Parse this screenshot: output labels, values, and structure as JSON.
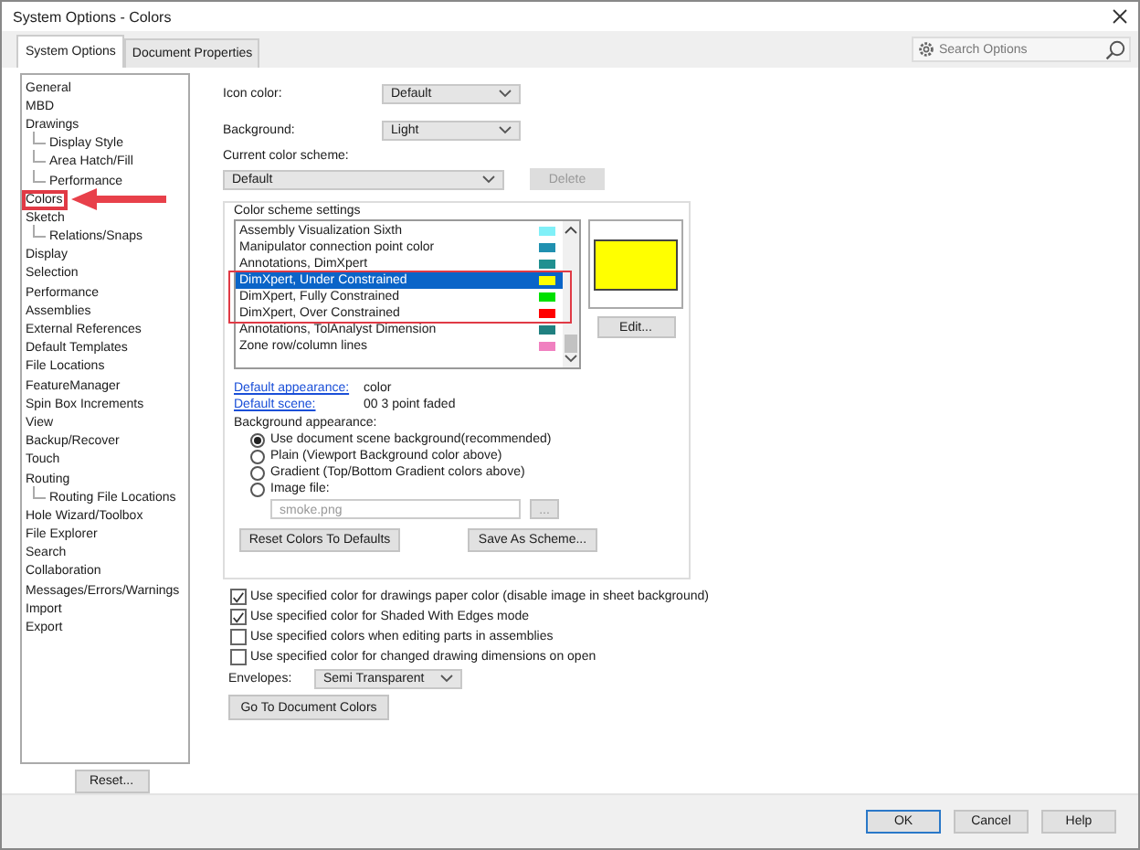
{
  "window": {
    "title": "System Options - Colors"
  },
  "tabs": [
    {
      "label": "System Options",
      "selected": true
    },
    {
      "label": "Document Properties",
      "selected": false
    }
  ],
  "search": {
    "placeholder": "Search Options"
  },
  "tree": [
    {
      "label": "General",
      "highlighted": false
    },
    {
      "label": "MBD",
      "highlighted": false
    },
    {
      "label": "Drawings",
      "highlighted": false,
      "children": [
        {
          "label": "Display Style",
          "highlighted": false
        },
        {
          "label": "Area Hatch/Fill",
          "highlighted": false
        },
        {
          "label": "Performance",
          "highlighted": false
        }
      ]
    },
    {
      "label": "Colors",
      "highlighted": true
    },
    {
      "label": "Sketch",
      "highlighted": false,
      "children": [
        {
          "label": "Relations/Snaps",
          "highlighted": false
        }
      ]
    },
    {
      "label": "Display",
      "highlighted": false
    },
    {
      "label": "Selection",
      "highlighted": false
    },
    {
      "label": "Performance",
      "highlighted": false
    },
    {
      "label": "Assemblies",
      "highlighted": false
    },
    {
      "label": "External References",
      "highlighted": false
    },
    {
      "label": "Default Templates",
      "highlighted": false
    },
    {
      "label": "File Locations",
      "highlighted": false
    },
    {
      "label": "FeatureManager",
      "highlighted": false
    },
    {
      "label": "Spin Box Increments",
      "highlighted": false
    },
    {
      "label": "View",
      "highlighted": false
    },
    {
      "label": "Backup/Recover",
      "highlighted": false
    },
    {
      "label": "Touch",
      "highlighted": false
    },
    {
      "label": "Routing",
      "highlighted": false,
      "children": [
        {
          "label": "Routing File Locations",
          "highlighted": false
        }
      ]
    },
    {
      "label": "Hole Wizard/Toolbox",
      "highlighted": false
    },
    {
      "label": "File Explorer",
      "highlighted": false
    },
    {
      "label": "Search",
      "highlighted": false
    },
    {
      "label": "Collaboration",
      "highlighted": false
    },
    {
      "label": "Messages/Errors/Warnings",
      "highlighted": false
    },
    {
      "label": "Import",
      "highlighted": false
    },
    {
      "label": "Export",
      "highlighted": false
    }
  ],
  "reset_button": "Reset...",
  "icon_color": {
    "label": "Icon color:",
    "value": "Default"
  },
  "background": {
    "label": "Background:",
    "value": "Light"
  },
  "current_scheme": {
    "label": "Current color scheme:",
    "value": "Default",
    "delete_button": "Delete",
    "delete_disabled": true
  },
  "scheme_settings": {
    "title": "Color scheme settings",
    "rows": [
      {
        "label": "Assembly Visualization Sixth",
        "color": "#80f0f8",
        "selected": false,
        "highlighted": false
      },
      {
        "label": "Manipulator connection point color",
        "color": "#2090b0",
        "selected": false,
        "highlighted": false
      },
      {
        "label": "Annotations, DimXpert",
        "color": "#209090",
        "selected": false,
        "highlighted": false
      },
      {
        "label": "DimXpert, Under Constrained",
        "color": "#ffff00",
        "selected": true,
        "highlighted": true
      },
      {
        "label": "DimXpert, Fully Constrained",
        "color": "#00e000",
        "selected": false,
        "highlighted": true
      },
      {
        "label": "DimXpert, Over Constrained",
        "color": "#ff0000",
        "selected": false,
        "highlighted": true
      },
      {
        "label": "Annotations, TolAnalyst Dimension",
        "color": "#208080",
        "selected": false,
        "highlighted": false
      },
      {
        "label": "Zone row/column lines",
        "color": "#f080c0",
        "selected": false,
        "highlighted": false
      }
    ],
    "edit_button": "Edit...",
    "default_appearance": {
      "link": "Default appearance:",
      "value": "color"
    },
    "default_scene": {
      "link": "Default scene:",
      "value": "00 3 point faded"
    },
    "background_appearance": "Background appearance:",
    "radios": [
      {
        "label": "Use document scene background(recommended)",
        "selected": true
      },
      {
        "label": "Plain (Viewport Background color above)",
        "selected": false
      },
      {
        "label": "Gradient (Top/Bottom Gradient colors above)",
        "selected": false
      },
      {
        "label": "Image file:",
        "selected": false
      }
    ],
    "image_file": "smoke.png",
    "browse_button": "...",
    "reset_colors_button": "Reset Colors To Defaults",
    "save_scheme_button": "Save As Scheme..."
  },
  "checkboxes": [
    {
      "label": "Use specified color for drawings paper color (disable image in sheet background)",
      "checked": true
    },
    {
      "label": "Use specified color for Shaded With Edges mode",
      "checked": true
    },
    {
      "label": "Use specified colors when editing parts in assemblies",
      "checked": false
    },
    {
      "label": "Use specified color for changed drawing dimensions on open",
      "checked": false
    }
  ],
  "envelopes": {
    "label": "Envelopes:",
    "value": "Semi Transparent"
  },
  "go_to_document_colors": "Go To Document Colors",
  "buttons": [
    {
      "label": "OK",
      "default": true
    },
    {
      "label": "Cancel",
      "default": false
    },
    {
      "label": "Help",
      "default": false
    }
  ]
}
